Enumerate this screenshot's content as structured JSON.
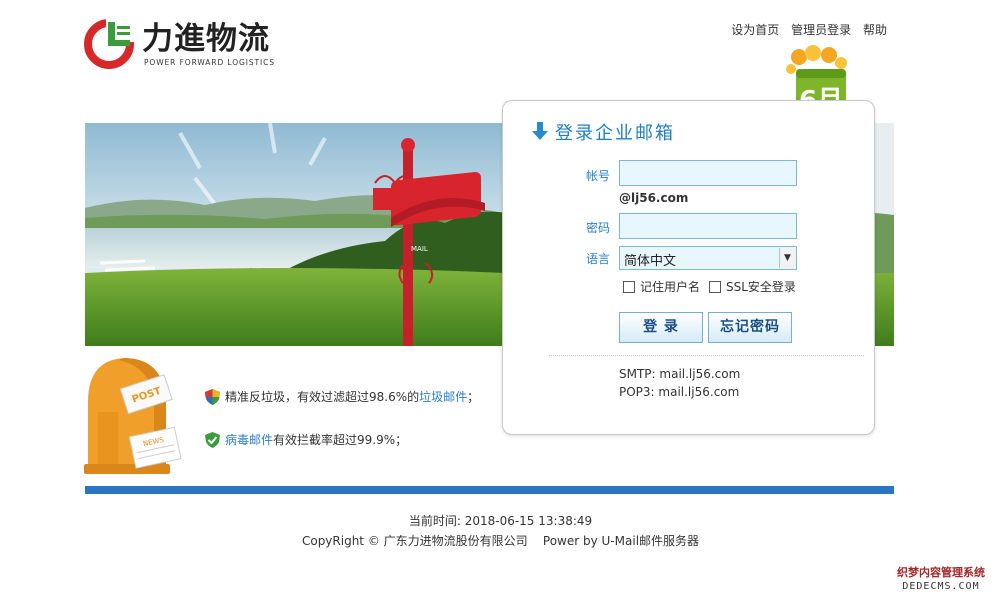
{
  "logo": {
    "name_cn": "力進物流",
    "name_en": "POWER FORWARD LOGISTICS",
    "red": "#d62828",
    "green": "#3c9b3c"
  },
  "toplinks": [
    "设为首页",
    "管理员登录",
    "帮助"
  ],
  "calendar": {
    "month": "6月"
  },
  "login": {
    "title": "登录企业邮箱",
    "account_label": "帐号",
    "account_value": "",
    "domain": "@lj56.com",
    "password_label": "密码",
    "language_label": "语言",
    "language_selected": "简体中文",
    "remember_label": "记住用户名",
    "ssl_label": "SSL安全登录",
    "login_button": "登 录",
    "forgot_button": "忘记密码",
    "smtp": "SMTP: mail.lj56.com",
    "pop3": "POP3: mail.lj56.com"
  },
  "banner": {
    "mailbox_text": "MAIL"
  },
  "postbox": {
    "post_text": "POST",
    "news_text": "NEWS"
  },
  "features": {
    "f1_before": "精准反垃圾，有效过滤超过98.6%的",
    "f1_link": "垃圾邮件",
    "f1_after": "；",
    "f2_link": "病毒邮件",
    "f2_after": "有效拦截率超过99.9%；"
  },
  "footer": {
    "time": "当前时间: 2018-06-15 13:38:49",
    "copyright": "CopyRight © 广东力进物流股份有限公司",
    "powered": "Power by U-Mail邮件服务器"
  },
  "watermark": {
    "line1": "织梦内容管理系统",
    "line2": "DEDECMS.COM"
  },
  "colors": {
    "accent": "#2b75c2",
    "link": "#2a7fc5"
  }
}
